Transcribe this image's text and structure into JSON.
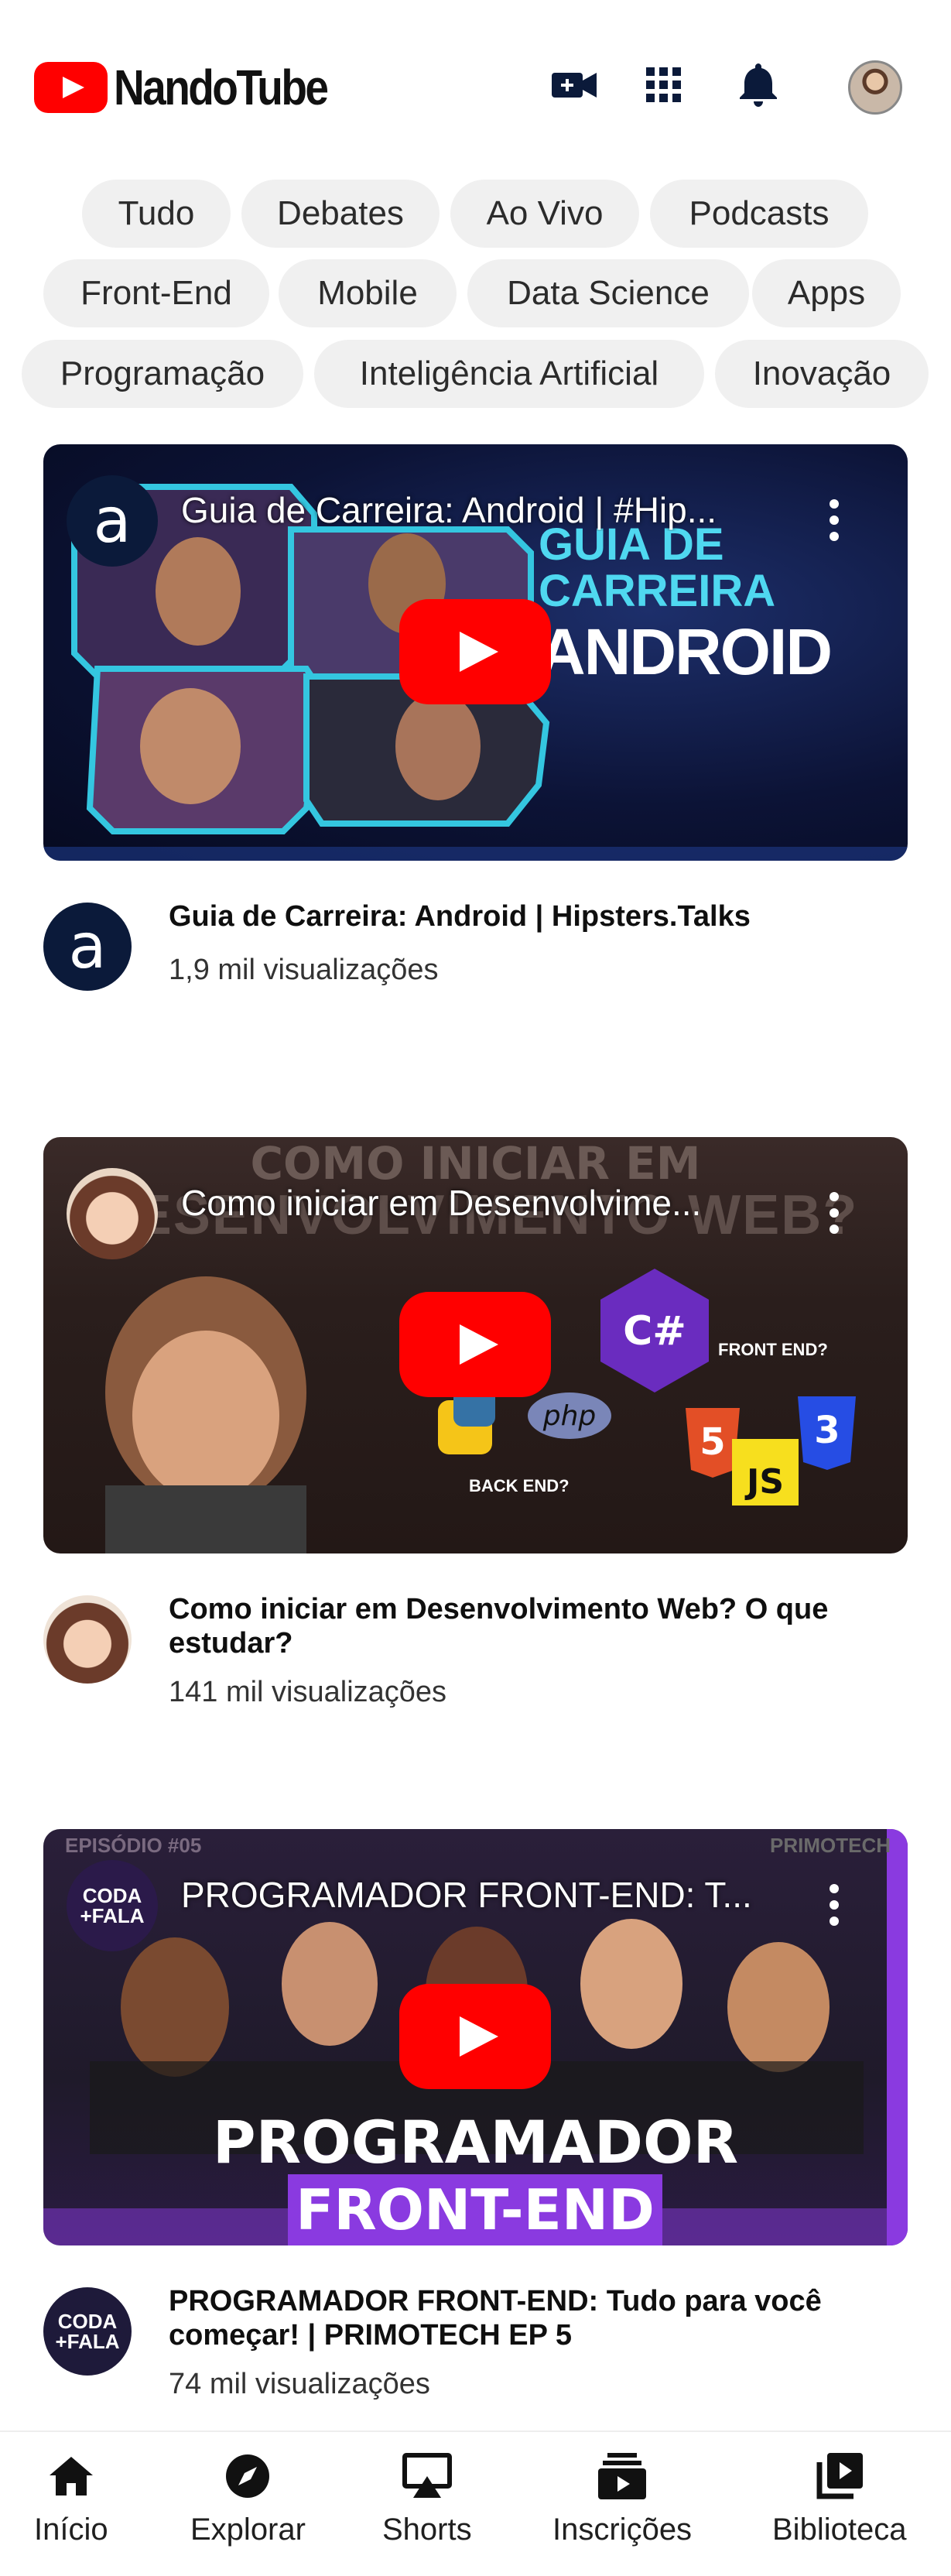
{
  "header": {
    "brand": "NandoTube",
    "icons": [
      "upload-video-icon",
      "apps-grid-icon",
      "notifications-bell-icon",
      "account-avatar"
    ]
  },
  "chips": [
    [
      "Tudo",
      "Debates",
      "Ao Vivo",
      "Podcasts"
    ],
    [
      "Front-End",
      "Mobile",
      "Data Science",
      "Apps"
    ],
    [
      "Programação",
      "Inteligência Artificial",
      "Inovação"
    ]
  ],
  "videos": [
    {
      "overlay_title": "Guia de Carreira: Android | #Hip...",
      "thumb_text_1": "GUIA DE",
      "thumb_text_2": "CARREIRA",
      "thumb_text_3": "ANDROID",
      "title": "Guia de Carreira: Android | Hipsters.Talks",
      "views": "1,9 mil visualizações"
    },
    {
      "overlay_title": "Como iniciar em Desenvolvime...",
      "thumb_text_1": "COMO INICIAR EM",
      "thumb_text_2": "DESENVOLVIMENTO WEB?",
      "thumb_text_3": "FRONT END?",
      "thumb_text_4": "BACK END?",
      "title": "Como iniciar em Desenvolvimento Web? O que estudar?",
      "views": "141 mil visualizações"
    },
    {
      "overlay_title": "PROGRAMADOR FRONT-END: T...",
      "thumb_text_1": "EPISÓDIO #05",
      "thumb_text_2": "PRIMOTECH",
      "thumb_text_3": "PROGRAMADOR",
      "thumb_text_4": "FRONT-END",
      "channel_badge_1": "CODA",
      "channel_badge_2": "+FALA",
      "title": "PROGRAMADOR FRONT-END: Tudo para você começar! | PRIMOTECH EP 5",
      "views": "74 mil visualizações"
    }
  ],
  "bottom_nav": [
    {
      "label": "Início",
      "icon": "home-icon"
    },
    {
      "label": "Explorar",
      "icon": "explore-compass-icon"
    },
    {
      "label": "Shorts",
      "icon": "shorts-cast-icon"
    },
    {
      "label": "Inscrições",
      "icon": "subscriptions-icon"
    },
    {
      "label": "Biblioteca",
      "icon": "library-icon"
    }
  ],
  "colors": {
    "brand_red": "#ff0000",
    "chip_bg": "#f0f0f0",
    "icon_dark": "#0b1a3a"
  }
}
